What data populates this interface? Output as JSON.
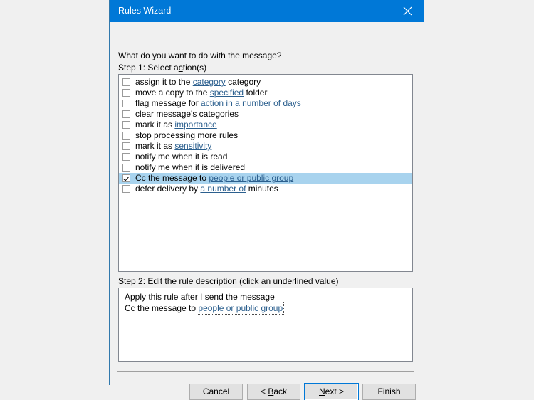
{
  "window": {
    "title": "Rules Wizard",
    "close_icon": "close-icon"
  },
  "heading": "What do you want to do with the message?",
  "step1": {
    "label_pre": "Step 1: Select a",
    "label_accel": "c",
    "label_post": "tion(s)",
    "actions": [
      {
        "checked": false,
        "pre": "assign it to the ",
        "link": "category",
        "post": " category"
      },
      {
        "checked": false,
        "pre": "move a copy to the ",
        "link": "specified",
        "post": " folder"
      },
      {
        "checked": false,
        "pre": "flag message for ",
        "link": "action in a number of days",
        "post": ""
      },
      {
        "checked": false,
        "pre": "clear message's categories",
        "link": "",
        "post": ""
      },
      {
        "checked": false,
        "pre": "mark it as ",
        "link": "importance",
        "post": ""
      },
      {
        "checked": false,
        "pre": "stop processing more rules",
        "link": "",
        "post": ""
      },
      {
        "checked": false,
        "pre": "mark it as ",
        "link": "sensitivity",
        "post": ""
      },
      {
        "checked": false,
        "pre": "notify me when it is read",
        "link": "",
        "post": ""
      },
      {
        "checked": false,
        "pre": "notify me when it is delivered",
        "link": "",
        "post": ""
      },
      {
        "checked": true,
        "pre": "Cc the message to ",
        "link": "people or public group",
        "post": ""
      },
      {
        "checked": false,
        "pre": "defer delivery by ",
        "link": "a number of",
        "post": " minutes"
      }
    ]
  },
  "step2": {
    "label_pre": "Step 2: Edit the rule ",
    "label_accel": "d",
    "label_post": "escription (click an underlined value)",
    "lines": [
      {
        "pre": "Apply this rule after I send the message",
        "link": "",
        "post": "",
        "focused": false
      },
      {
        "pre": "Cc the message to ",
        "link": "people or public group",
        "post": "",
        "focused": true
      }
    ]
  },
  "buttons": {
    "cancel": {
      "pre": "Cancel",
      "accel": "",
      "post": ""
    },
    "back": {
      "pre": "< ",
      "accel": "B",
      "post": "ack"
    },
    "next": {
      "pre": "",
      "accel": "N",
      "post": "ext >"
    },
    "finish": {
      "pre": "Finish",
      "accel": "",
      "post": ""
    }
  },
  "colors": {
    "titlebar": "#0078d7",
    "selection": "#a8d3ee",
    "link": "#2b5f8e",
    "dialog_border": "#3179ad",
    "default_button_ring": "#0078d7"
  }
}
